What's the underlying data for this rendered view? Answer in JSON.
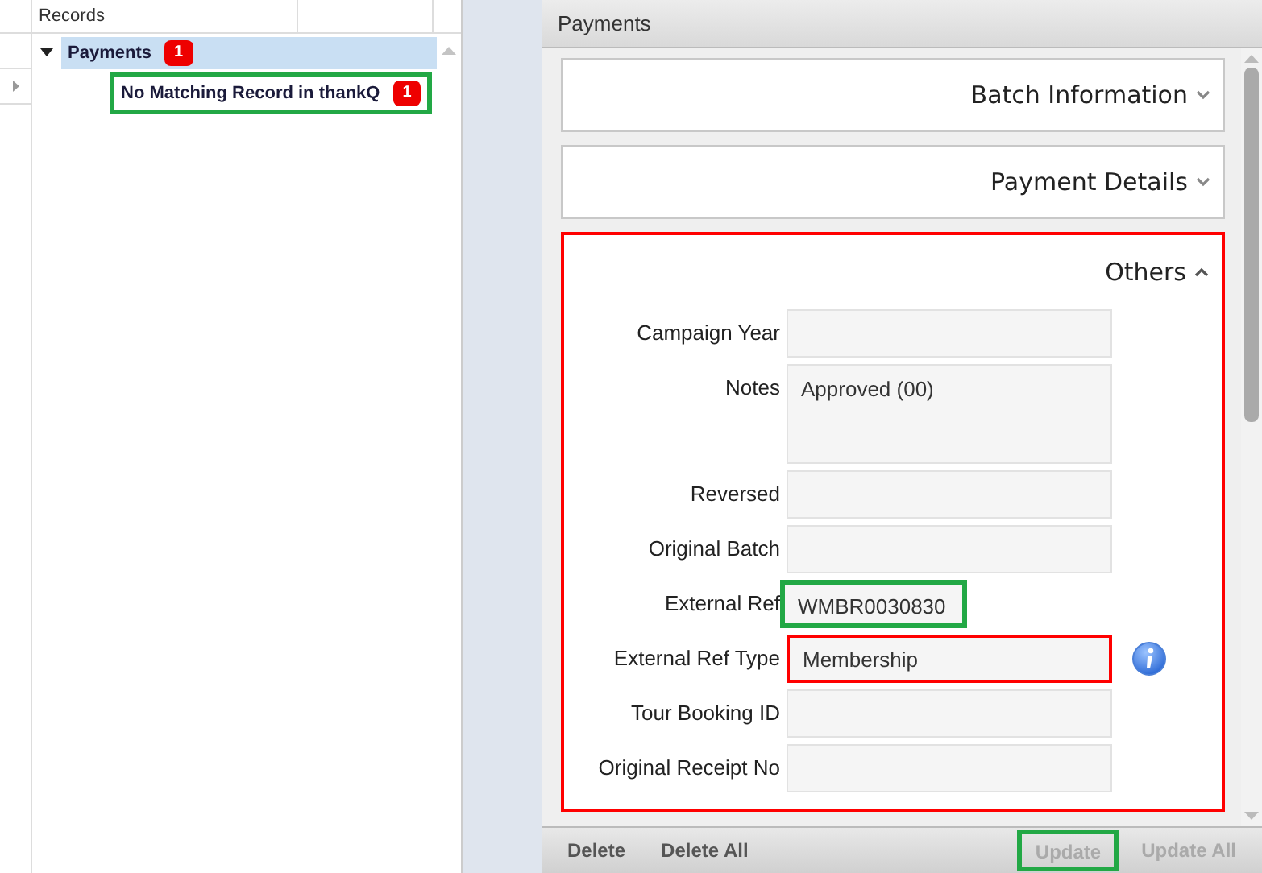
{
  "tree": {
    "header": "Records",
    "nodes": [
      {
        "label": "Payments",
        "badge": "1",
        "expanded": true,
        "selected": true,
        "children": [
          {
            "label": "No Matching Record in thankQ",
            "badge": "1",
            "selected": false,
            "color": "#22a845"
          }
        ]
      }
    ]
  },
  "panel": {
    "title": "Payments",
    "sections": [
      {
        "title": "Batch Information",
        "expanded": false
      },
      {
        "title": "Payment Details",
        "expanded": false
      },
      {
        "title": "Others",
        "expanded": true,
        "color": "#ff0000",
        "fields": [
          {
            "label": "Campaign Year",
            "kind": "text"
          },
          {
            "label": "Notes",
            "value": "Approved (00)",
            "kind": "multiline"
          },
          {
            "label": "Reversed",
            "kind": "text"
          },
          {
            "label": "Original Batch",
            "kind": "text"
          },
          {
            "label": "External Ref",
            "value": "WMBR0030830",
            "kind": "text",
            "color": "#22a845"
          },
          {
            "label": "External Ref Type",
            "value": "Membership",
            "kind": "text",
            "color": "#ff0000",
            "info": true
          },
          {
            "label": "Tour Booking ID",
            "kind": "text"
          },
          {
            "label": "Original Receipt No",
            "kind": "text"
          }
        ]
      }
    ],
    "buttons": [
      {
        "label": "Delete",
        "disabled": false
      },
      {
        "label": "Delete All",
        "disabled": false
      },
      {
        "label": "Update",
        "disabled": true,
        "color": "#22a845"
      },
      {
        "label": "Update All",
        "disabled": true
      }
    ]
  }
}
